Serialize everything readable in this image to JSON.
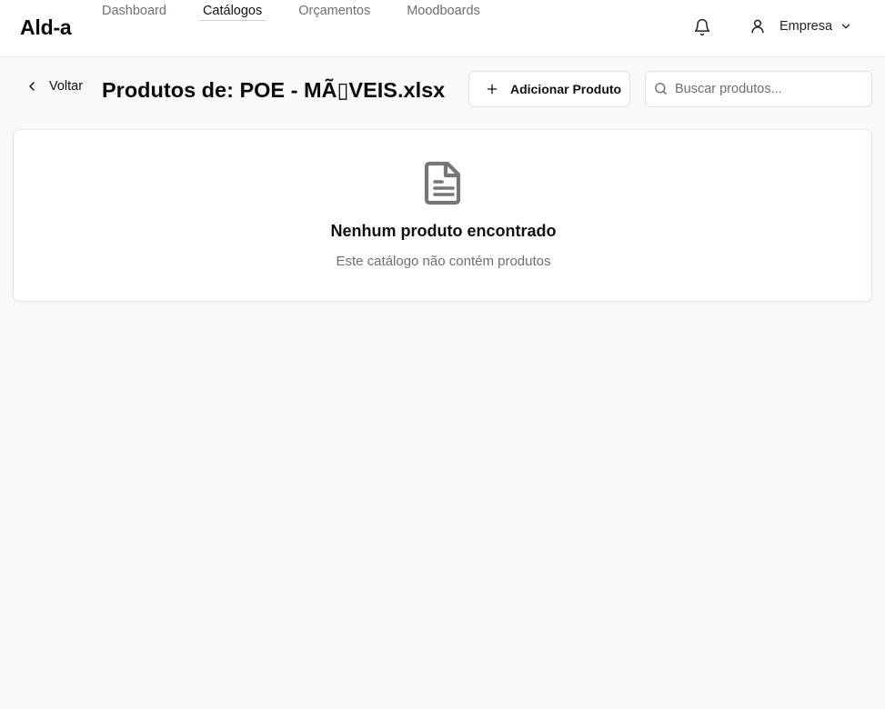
{
  "app": {
    "logo": "Ald-a"
  },
  "nav": {
    "items": [
      {
        "label": "Dashboard",
        "active": false
      },
      {
        "label": "Catálogos",
        "active": true
      },
      {
        "label": "Orçamentos",
        "active": false
      },
      {
        "label": "Moodboards",
        "active": false
      }
    ]
  },
  "header": {
    "notifications_icon": "bell-icon",
    "user": {
      "icon": "user-icon",
      "name": "Empresa",
      "menu_icon": "chevron-down-icon"
    }
  },
  "toolbar": {
    "back_label": "Voltar",
    "title": "Produtos de: POE - MÃ▯VEIS.xlsx",
    "add_label": "Adicionar Produto",
    "search": {
      "placeholder": "Buscar produtos...",
      "value": ""
    }
  },
  "empty_state": {
    "icon": "document-icon",
    "title": "Nenhum produto encontrado",
    "subtitle": "Este catálogo não contém produtos"
  },
  "colors": {
    "background": "#f8f9fb",
    "surface": "#ffffff",
    "border": "#e3e5e8",
    "text_primary": "#111111",
    "text_muted": "#6b6f76",
    "icon_gray": "#777777"
  }
}
